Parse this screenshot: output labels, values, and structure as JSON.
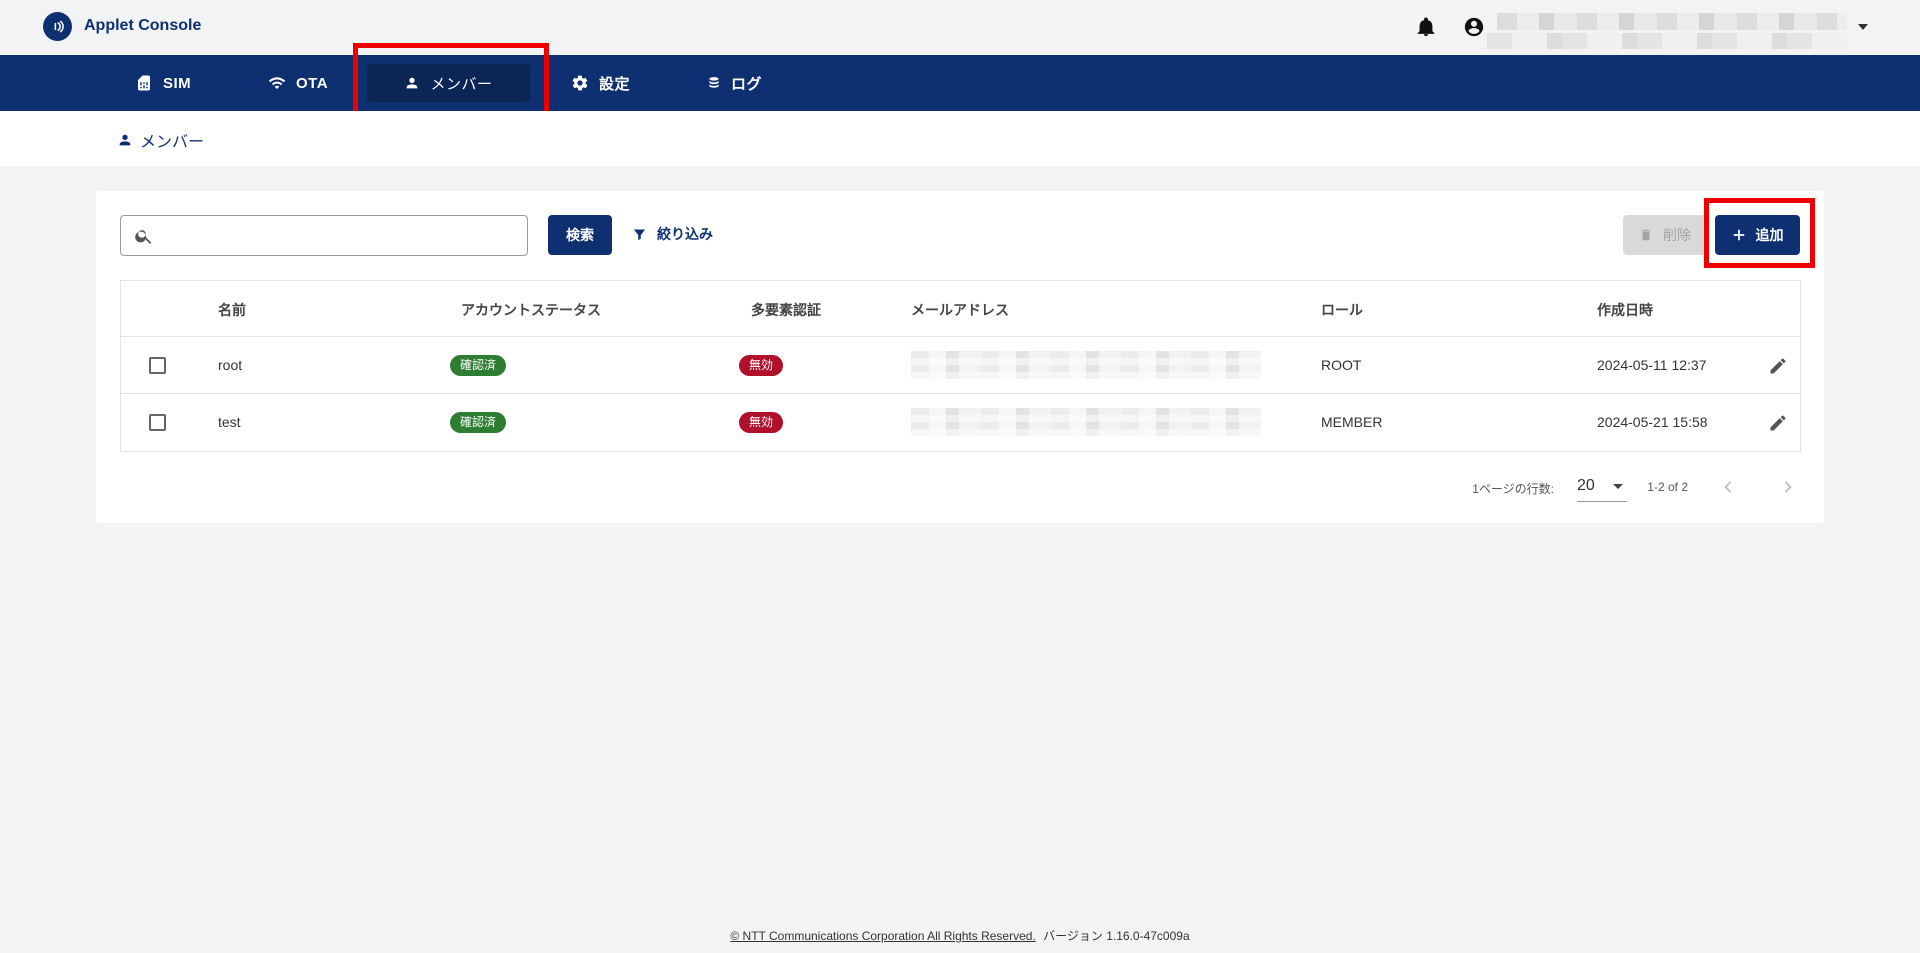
{
  "app": {
    "title": "Applet Console"
  },
  "nav": {
    "items": [
      {
        "label": "SIM",
        "icon": "sim-card-icon"
      },
      {
        "label": "OTA",
        "icon": "wifi-icon"
      },
      {
        "label": "メンバー",
        "icon": "person-icon",
        "active": true
      },
      {
        "label": "設定",
        "icon": "gear-icon"
      },
      {
        "label": "ログ",
        "icon": "database-icon"
      }
    ]
  },
  "breadcrumb": {
    "label": "メンバー"
  },
  "toolbar": {
    "search_placeholder": "",
    "search_label": "検索",
    "filter_label": "絞り込み",
    "delete_label": "削除",
    "add_label": "追加"
  },
  "table": {
    "headers": [
      "名前",
      "アカウントステータス",
      "多要素認証",
      "メールアドレス",
      "ロール",
      "作成日時"
    ],
    "rows": [
      {
        "name": "root",
        "status": "確認済",
        "mfa": "無効",
        "role": "ROOT",
        "created": "2024-05-11 12:37"
      },
      {
        "name": "test",
        "status": "確認済",
        "mfa": "無効",
        "role": "MEMBER",
        "created": "2024-05-21 15:58"
      }
    ]
  },
  "pagination": {
    "rows_per_page_label": "1ページの行数:",
    "rows_per_page": "20",
    "range": "1-2 of 2"
  },
  "footer": {
    "copyright": "© NTT Communications Corporation All Rights Reserved.",
    "version": "バージョン 1.16.0-47c009a"
  },
  "colors": {
    "brand": "#0f3070",
    "highlight": "#ee0000",
    "badge_confirmed": "#2e7d32",
    "badge_disabled": "#b0102a"
  }
}
